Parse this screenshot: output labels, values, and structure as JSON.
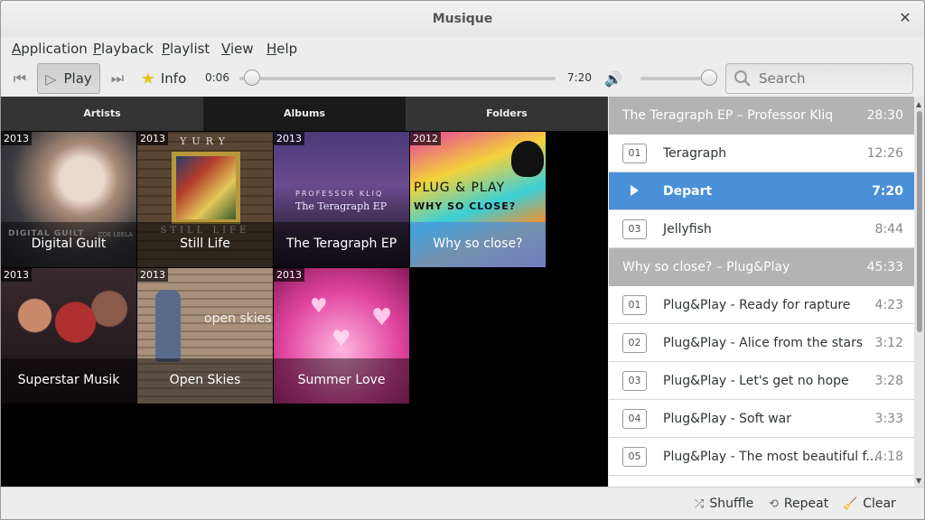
{
  "window": {
    "title": "Musique",
    "close_glyph": "✕"
  },
  "menu": [
    {
      "accel": "A",
      "rest": "pplication"
    },
    {
      "accel": "P",
      "rest": "layback"
    },
    {
      "accel": "P",
      "rest": "laylist"
    },
    {
      "accel": "V",
      "rest": "iew"
    },
    {
      "accel": "H",
      "rest": "elp"
    }
  ],
  "toolbar": {
    "prev_icon": "⏮",
    "play_icon": "▷",
    "play_label": "Play",
    "next_icon": "⏭",
    "info_icon": "★",
    "info_label": "Info",
    "elapsed": "0:06",
    "total": "7:20",
    "volume_icon": "🔊",
    "search_placeholder": "Search",
    "progress_fraction": 0.014,
    "volume_fraction": 0.95
  },
  "tabs": [
    "Artists",
    "Albums",
    "Folders"
  ],
  "active_tab": "Albums",
  "albums": [
    {
      "year": "2013",
      "title": "Digital Guilt"
    },
    {
      "year": "2013",
      "title": "Still Life"
    },
    {
      "year": "2013",
      "title": "The Teragraph EP"
    },
    {
      "year": "2012",
      "title": "Why so close?"
    },
    {
      "year": "2013",
      "title": "Superstar Musik"
    },
    {
      "year": "2013",
      "title": "Open Skies"
    },
    {
      "year": "2013",
      "title": "Summer Love"
    }
  ],
  "album_art_text": {
    "still_life_top": "YURY",
    "still_life_bottom": "STILL LIFE",
    "teragraph_artist": "PROFESSOR KLIQ",
    "teragraph_title": "The Teragraph EP",
    "why_line1": "PLUG & PLAY",
    "why_line2": "WHY SO CLOSE?",
    "open_skies": "open skies",
    "digital_guilt": "DIGITAL GUILT",
    "digital_guilt_artist": "ZOE LEELA"
  },
  "playlist": [
    {
      "header": "The Teragraph EP – Professor Kliq",
      "duration": "28:30",
      "tracks": [
        {
          "num": "01",
          "name": "Teragraph",
          "dur": "12:26"
        },
        {
          "num": "",
          "name": "Depart",
          "dur": "7:20",
          "playing": true
        },
        {
          "num": "03",
          "name": "Jellyfish",
          "dur": "8:44"
        }
      ]
    },
    {
      "header": "Why so close? – Plug&Play",
      "duration": "45:33",
      "tracks": [
        {
          "num": "01",
          "name": "Plug&Play - Ready for rapture",
          "dur": "4:23"
        },
        {
          "num": "02",
          "name": "Plug&Play - Alice from the stars",
          "dur": "3:12"
        },
        {
          "num": "03",
          "name": "Plug&Play - Let's get no hope",
          "dur": "3:28"
        },
        {
          "num": "04",
          "name": "Plug&Play - Soft war",
          "dur": "3:33"
        },
        {
          "num": "05",
          "name": "Plug&Play - The most beautiful f...",
          "dur": "4:18"
        }
      ]
    }
  ],
  "bottom": {
    "shuffle": "Shuffle",
    "repeat": "Repeat",
    "clear": "Clear"
  },
  "colors": {
    "accent": "#4a90d9",
    "group_header": "#b3b3b3"
  }
}
